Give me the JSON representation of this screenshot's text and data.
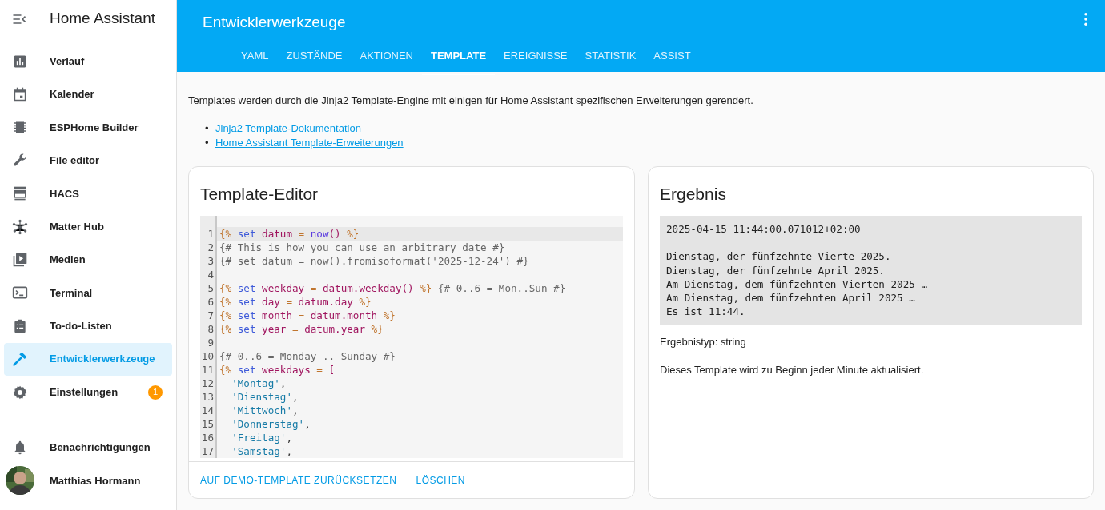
{
  "sidebar": {
    "title": "Home Assistant",
    "items": [
      {
        "kind": "chart",
        "label": "Verlauf",
        "selected": false
      },
      {
        "kind": "calendar",
        "label": "Kalender",
        "selected": false
      },
      {
        "kind": "chip",
        "label": "ESPHome Builder",
        "selected": false
      },
      {
        "kind": "wrench",
        "label": "File editor",
        "selected": false
      },
      {
        "kind": "store",
        "label": "HACS",
        "selected": false
      },
      {
        "kind": "hub",
        "label": "Matter Hub",
        "selected": false
      },
      {
        "kind": "media",
        "label": "Medien",
        "selected": false
      },
      {
        "kind": "terminal",
        "label": "Terminal",
        "selected": false
      },
      {
        "kind": "clipboard",
        "label": "To-do-Listen",
        "selected": false
      },
      {
        "kind": "hammer",
        "label": "Entwicklerwerkzeuge",
        "selected": true
      },
      {
        "kind": "gear",
        "label": "Einstellungen",
        "selected": false,
        "badge": "1"
      }
    ],
    "notifications": "Benachrichtigungen",
    "user": "Matthias Hormann"
  },
  "header": {
    "title": "Entwicklerwerkzeuge"
  },
  "tabs": [
    {
      "label": "YAML",
      "selected": false
    },
    {
      "label": "ZUSTÄNDE",
      "selected": false
    },
    {
      "label": "AKTIONEN",
      "selected": false
    },
    {
      "label": "TEMPLATE",
      "selected": true
    },
    {
      "label": "EREIGNISSE",
      "selected": false
    },
    {
      "label": "STATISTIK",
      "selected": false
    },
    {
      "label": "ASSIST",
      "selected": false
    }
  ],
  "intro": "Templates werden durch die Jinja2 Template-Engine mit einigen für Home Assistant spezifischen Erweiterungen gerendert.",
  "links": [
    {
      "marker": "•",
      "text": "Jinja2 Template-Dokumentation"
    },
    {
      "marker": "•",
      "text": "Home Assistant Template-Erweiterungen"
    }
  ],
  "editor": {
    "title": "Template-Editor",
    "lines": [
      {
        "number": "1",
        "active": true,
        "tokens": [
          {
            "kind": "delim",
            "text": "{%"
          },
          {
            "kind": "keyword",
            "text": " set "
          },
          {
            "kind": "var",
            "text": "datum"
          },
          {
            "kind": "delim",
            "text": " = "
          },
          {
            "kind": "func",
            "text": "now"
          },
          {
            "kind": "var",
            "text": "()"
          },
          {
            "kind": "delim",
            "text": " %}"
          }
        ]
      },
      {
        "number": "2",
        "active": false,
        "tokens": [
          {
            "kind": "comment",
            "text": "{# This is how you can use an arbitrary date #}"
          }
        ]
      },
      {
        "number": "3",
        "active": false,
        "tokens": [
          {
            "kind": "comment",
            "text": "{# set datum = now().fromisoformat('2025-12-24') #}"
          }
        ]
      },
      {
        "number": "4",
        "active": false
      },
      {
        "number": "5",
        "active": false,
        "tokens": [
          {
            "kind": "delim",
            "text": "{%"
          },
          {
            "kind": "keyword",
            "text": " set "
          },
          {
            "kind": "var",
            "text": "weekday"
          },
          {
            "kind": "delim",
            "text": " = "
          },
          {
            "kind": "var",
            "text": "datum.weekday()"
          },
          {
            "kind": "delim",
            "text": " %}"
          },
          {
            "kind": "comment",
            "text": " {# 0..6 = Mon..Sun #}"
          }
        ]
      },
      {
        "number": "6",
        "active": false,
        "tokens": [
          {
            "kind": "delim",
            "text": "{%"
          },
          {
            "kind": "keyword",
            "text": " set "
          },
          {
            "kind": "var",
            "text": "day"
          },
          {
            "kind": "delim",
            "text": " = "
          },
          {
            "kind": "var",
            "text": "datum.day"
          },
          {
            "kind": "delim",
            "text": " %}"
          }
        ]
      },
      {
        "number": "7",
        "active": false,
        "tokens": [
          {
            "kind": "delim",
            "text": "{%"
          },
          {
            "kind": "keyword",
            "text": " set "
          },
          {
            "kind": "var",
            "text": "month"
          },
          {
            "kind": "delim",
            "text": " = "
          },
          {
            "kind": "var",
            "text": "datum.month"
          },
          {
            "kind": "delim",
            "text": " %}"
          }
        ]
      },
      {
        "number": "8",
        "active": false,
        "tokens": [
          {
            "kind": "delim",
            "text": "{%"
          },
          {
            "kind": "keyword",
            "text": " set "
          },
          {
            "kind": "var",
            "text": "year"
          },
          {
            "kind": "delim",
            "text": " = "
          },
          {
            "kind": "var",
            "text": "datum.year"
          },
          {
            "kind": "delim",
            "text": " %}"
          }
        ]
      },
      {
        "number": "9",
        "active": false
      },
      {
        "number": "10",
        "active": false,
        "tokens": [
          {
            "kind": "comment",
            "text": "{# 0..6 = Monday .. Sunday #}"
          }
        ]
      },
      {
        "number": "11",
        "active": false,
        "tokens": [
          {
            "kind": "delim",
            "text": "{%"
          },
          {
            "kind": "keyword",
            "text": " set "
          },
          {
            "kind": "var",
            "text": "weekdays"
          },
          {
            "kind": "delim",
            "text": " = "
          },
          {
            "kind": "var",
            "text": "["
          }
        ]
      },
      {
        "number": "12",
        "active": false,
        "tokens": [
          {
            "kind": "string",
            "text": "  'Montag'"
          },
          {
            "kind": "plain",
            "text": ","
          }
        ]
      },
      {
        "number": "13",
        "active": false,
        "tokens": [
          {
            "kind": "string",
            "text": "  'Dienstag'"
          },
          {
            "kind": "plain",
            "text": ","
          }
        ]
      },
      {
        "number": "14",
        "active": false,
        "tokens": [
          {
            "kind": "string",
            "text": "  'Mittwoch'"
          },
          {
            "kind": "plain",
            "text": ","
          }
        ]
      },
      {
        "number": "15",
        "active": false,
        "tokens": [
          {
            "kind": "string",
            "text": "  'Donnerstag'"
          },
          {
            "kind": "plain",
            "text": ","
          }
        ]
      },
      {
        "number": "16",
        "active": false,
        "tokens": [
          {
            "kind": "string",
            "text": "  'Freitag'"
          },
          {
            "kind": "plain",
            "text": ","
          }
        ]
      },
      {
        "number": "17",
        "active": false,
        "tokens": [
          {
            "kind": "string",
            "text": "  'Samstag'"
          },
          {
            "kind": "plain",
            "text": ","
          }
        ]
      }
    ],
    "buttons": [
      "AUF DEMO-TEMPLATE ZURÜCKSETZEN",
      "LÖSCHEN"
    ]
  },
  "result": {
    "title": "Ergebnis",
    "output": [
      [
        "2025-04-15 11:44:00.071012+02:00"
      ],
      [
        "Dienstag, der fünfzehnte Vierte 2025.",
        "Dienstag, der fünfzehnte April 2025.",
        "Am Dienstag, dem fünfzehnten Vierten 2025 …",
        "Am Dienstag, dem fünfzehnten April 2025 …",
        "Es ist 11:44."
      ]
    ],
    "type": "Ergebnistyp: string",
    "note": "Dieses Template wird zu Beginn jeder Minute aktualisiert."
  }
}
